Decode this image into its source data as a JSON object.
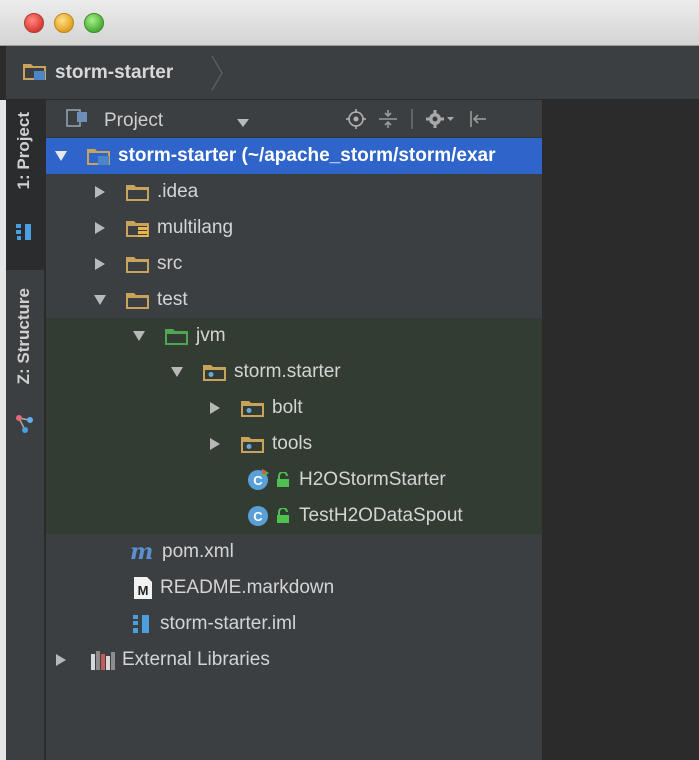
{
  "window": {
    "controls": [
      "close",
      "minimize",
      "zoom"
    ]
  },
  "navbar": {
    "crumb_label": "storm-starter",
    "crumb_icon": "module-folder-icon"
  },
  "tool_windows": {
    "project_tab": "1: Project",
    "structure_tab": "Z: Structure"
  },
  "panel": {
    "view_label": "Project",
    "toolbar_icons": [
      "scroll-from-source-icon",
      "collapse-all-icon",
      "gear-icon",
      "hide-panel-icon"
    ]
  },
  "tree": {
    "rows": [
      {
        "label": "storm-starter (~/apache_storm/storm/exar",
        "icon": "module-folder-icon",
        "expanded": true,
        "selected": true
      },
      {
        "label": ".idea",
        "icon": "folder-icon",
        "expanded": false
      },
      {
        "label": "multilang",
        "icon": "resource-folder-icon",
        "expanded": false
      },
      {
        "label": "src",
        "icon": "folder-icon",
        "expanded": false
      },
      {
        "label": "test",
        "icon": "folder-icon",
        "expanded": true
      },
      {
        "label": "jvm",
        "icon": "test-source-folder-icon",
        "expanded": true
      },
      {
        "label": "storm.starter",
        "icon": "package-icon",
        "expanded": true
      },
      {
        "label": "bolt",
        "icon": "package-icon",
        "expanded": false
      },
      {
        "label": "tools",
        "icon": "package-icon",
        "expanded": false
      },
      {
        "label": "H2OStormStarter",
        "icon": "runnable-class-icon"
      },
      {
        "label": "TestH2ODataSpout",
        "icon": "class-icon"
      },
      {
        "label": "pom.xml",
        "icon": "maven-icon"
      },
      {
        "label": "README.markdown",
        "icon": "markdown-file-icon"
      },
      {
        "label": "storm-starter.iml",
        "icon": "iml-file-icon"
      },
      {
        "label": "External Libraries",
        "icon": "libraries-icon",
        "expanded": false
      }
    ]
  },
  "colors": {
    "selection": "#2f65ca",
    "test_scope": "#323c32",
    "panel": "#3c3f41",
    "editor": "#2b2b2b"
  }
}
